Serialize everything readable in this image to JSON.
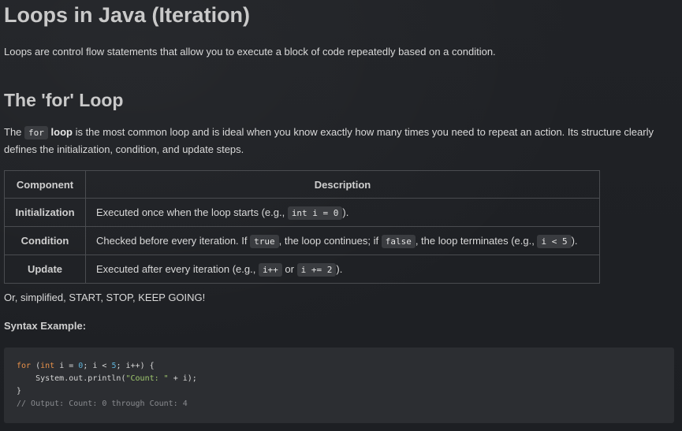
{
  "title": "Loops in Java (Iteration)",
  "intro": "Loops are control flow statements that allow you to execute a block of code repeatedly based on a condition.",
  "section": {
    "heading": "The 'for' Loop",
    "para_start": "The ",
    "para_code": "for",
    "para_bold": "loop",
    "para_rest": " is the most common loop and is ideal when you know exactly how many times you need to repeat an action. Its structure clearly defines the initialization, condition, and update steps."
  },
  "table": {
    "headers": [
      "Component",
      "Description"
    ],
    "rows": [
      {
        "name": "Initialization",
        "t1": "Executed once when the loop starts (e.g., ",
        "c1": "int i = 0",
        "t2": ")."
      },
      {
        "name": "Condition",
        "t1": "Checked before every iteration. If ",
        "c1": "true",
        "t2": ", the loop continues; if ",
        "c2": "false",
        "t3": ", the loop terminates (e.g., ",
        "c3": "i < 5",
        "t4": ")."
      },
      {
        "name": "Update",
        "t1": "Executed after every iteration (e.g., ",
        "c1": "i++",
        "t2": " or ",
        "c2": "i += 2",
        "t3": ")."
      }
    ]
  },
  "note": "Or, simplified, START, STOP, KEEP GOING!",
  "syntax_title": "Syntax Example:",
  "code": {
    "l1_kw": "for",
    "l1_a": " (",
    "l1_type": "int",
    "l1_b": " i = ",
    "l1_n0": "0",
    "l1_c": "; i < ",
    "l1_n5": "5",
    "l1_d": "; i++) {",
    "l2_a": "    System.out.println(",
    "l2_str": "\"Count: \"",
    "l2_b": " + i);",
    "l3": "}",
    "l4_comment": "// Output: Count: 0 through Count: 4"
  },
  "colors": {
    "background": "#1f2125",
    "code_bg": "#2c2e32",
    "keyword": "#e8914a",
    "number": "#5fb3d9",
    "string": "#9fc86e",
    "comment": "#8a8c90"
  }
}
